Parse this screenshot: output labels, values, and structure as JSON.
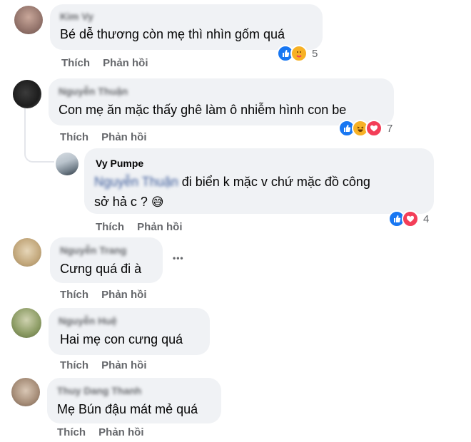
{
  "comments": [
    {
      "author": "Kim Vy",
      "text": "Bé dễ thương còn mẹ thì nhìn gốm quá",
      "like": "Thích",
      "reply": "Phản hồi",
      "reactions": [
        "like",
        "care"
      ],
      "count": "5"
    },
    {
      "author": "Nguyễn Thuận",
      "text": "Con mẹ ăn mặc thấy ghê làm ô nhiễm hình con be",
      "like": "Thích",
      "reply": "Phản hồi",
      "reactions": [
        "like",
        "haha",
        "love"
      ],
      "count": "7"
    },
    {
      "author": "Nguyễn Trang",
      "text": "Cưng quá đi à",
      "like": "Thích",
      "reply": "Phản hồi",
      "more": "•••"
    },
    {
      "author": "Nguyễn Huệ",
      "text": "Hai mẹ con cưng quá",
      "like": "Thích",
      "reply": "Phản hồi"
    },
    {
      "author": "Thuy Dang Thanh",
      "text": "Mẹ Bún đậu mát mẻ quá",
      "like": "Thích",
      "reply": "Phản hồi"
    }
  ],
  "reply": {
    "author": "Vy Pumpe",
    "mention": "Nguyễn Thuận",
    "text_line1": " đi biển k mặc v chứ mặc đồ công",
    "text_line2": "sở hả c ?",
    "emoji": "😅",
    "like": "Thích",
    "reply": "Phản hồi",
    "reactions": [
      "like",
      "love"
    ],
    "count": "4"
  },
  "colors": {
    "bubble": "#f0f2f5",
    "like": "#1877f2",
    "love": "#f33e58",
    "haha": "#f7b125",
    "muted": "#65676b"
  }
}
